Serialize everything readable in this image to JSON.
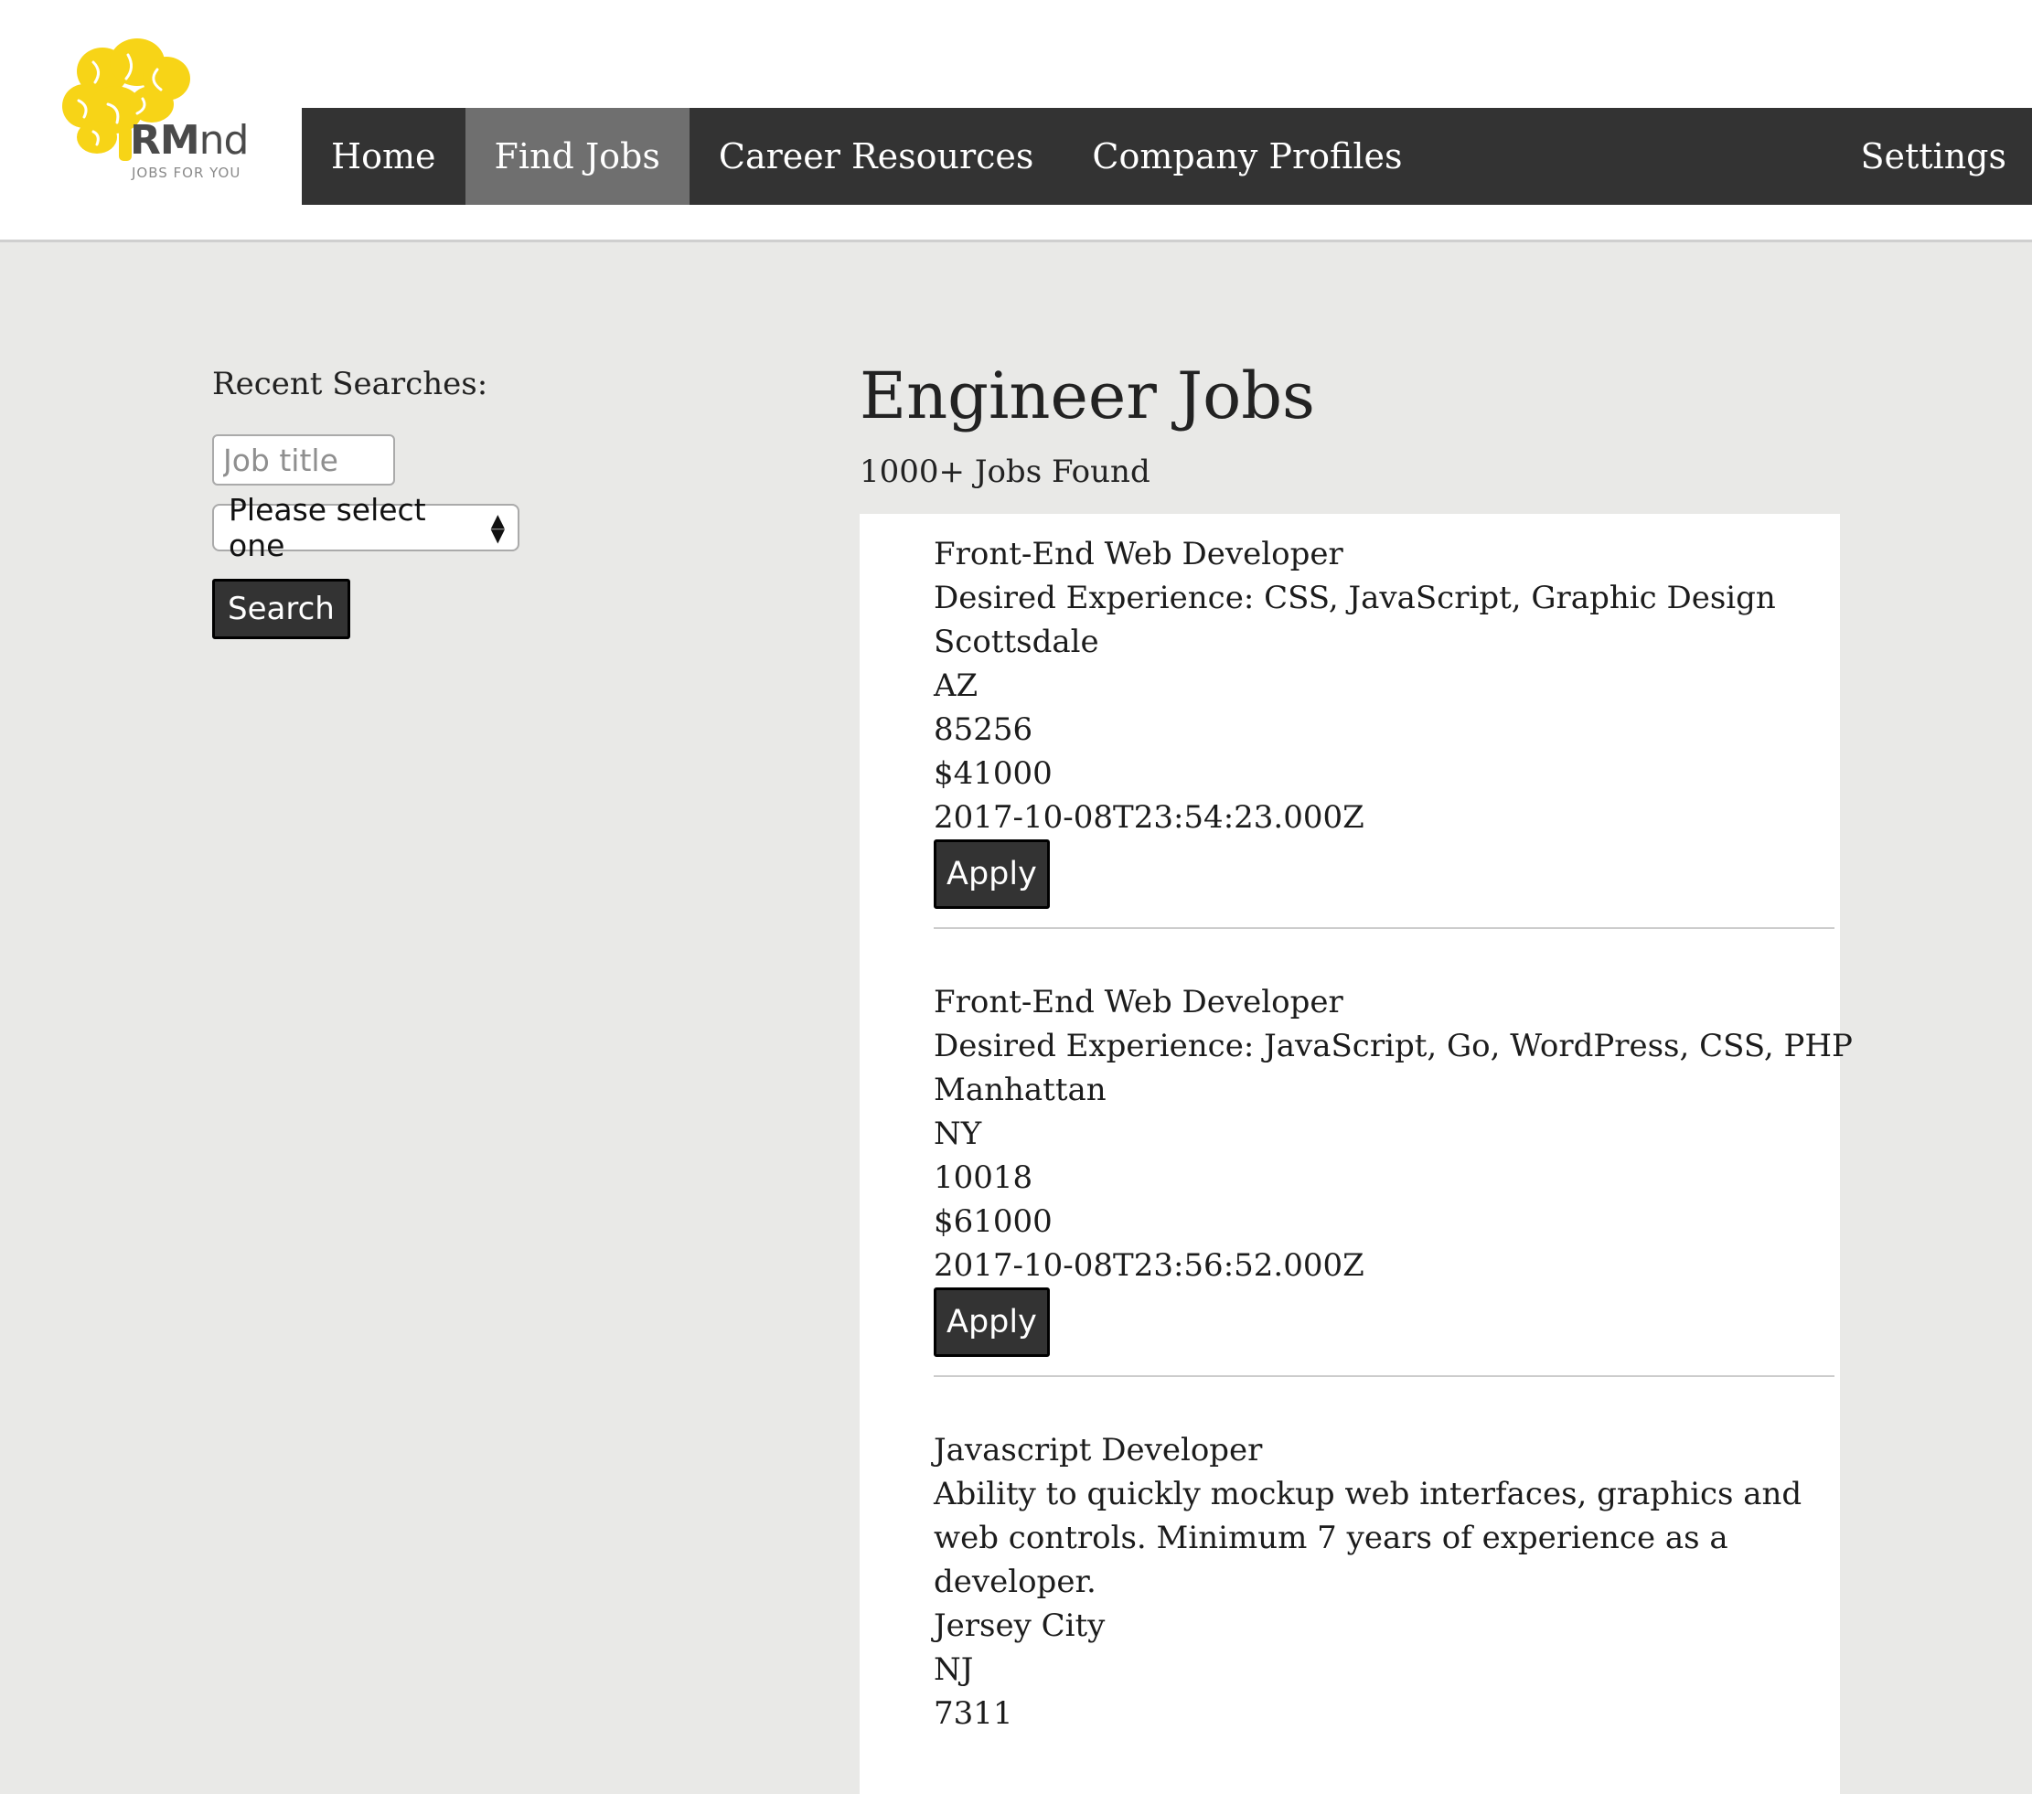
{
  "brand": {
    "name_bold": "RM",
    "name_rest": "nd",
    "tagline": "JOBS FOR YOU",
    "logo_color": "#f7d417"
  },
  "nav": {
    "items": [
      {
        "label": "Home",
        "active": false
      },
      {
        "label": "Find Jobs",
        "active": true
      },
      {
        "label": "Career Resources",
        "active": false
      },
      {
        "label": "Company Profiles",
        "active": false
      }
    ],
    "settings_label": "Settings",
    "bar_color": "#333333",
    "active_color": "#6f6f6f"
  },
  "sidebar": {
    "recent_label": "Recent Searches:",
    "job_title_placeholder": "Job title",
    "select_value": "Please select one",
    "search_label": "Search"
  },
  "main": {
    "title": "Engineer Jobs",
    "count_text": "1000+ Jobs Found",
    "apply_label": "Apply",
    "jobs": [
      {
        "title": "Front-End Web Developer",
        "description": "Desired Experience: CSS, JavaScript, Graphic Design",
        "city": "Scottsdale",
        "state": "AZ",
        "zip": "85256",
        "salary": "$41000",
        "posted": "2017-10-08T23:54:23.000Z"
      },
      {
        "title": "Front-End Web Developer",
        "description": "Desired Experience: JavaScript, Go, WordPress, CSS, PHP",
        "city": "Manhattan",
        "state": "NY",
        "zip": "10018",
        "salary": "$61000",
        "posted": "2017-10-08T23:56:52.000Z"
      },
      {
        "title": "Javascript Developer",
        "description": "Ability to quickly mockup web interfaces, graphics and web controls. Minimum 7 years of experience as a developer.",
        "city": "Jersey City",
        "state": "NJ",
        "zip": "7311"
      }
    ]
  }
}
